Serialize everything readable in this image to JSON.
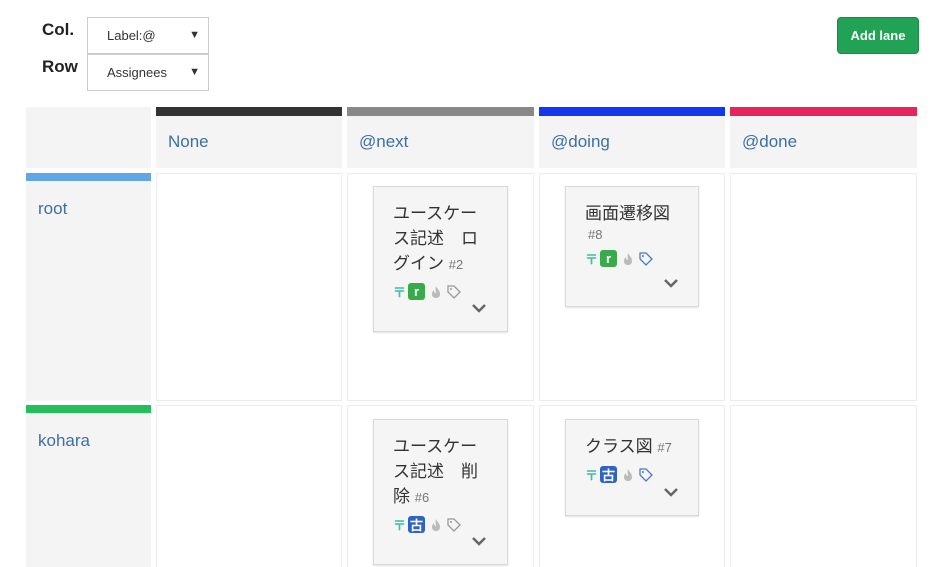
{
  "controls": {
    "col_label": "Col.",
    "row_label": "Row",
    "col_select": "Label:@",
    "row_select": "Assignees",
    "caret": "▼",
    "add_lane": "Add lane"
  },
  "columns": [
    {
      "name": "None",
      "color": "#333333"
    },
    {
      "name": "@next",
      "color": "#888888"
    },
    {
      "name": "@doing",
      "color": "#1238f2"
    },
    {
      "name": "@done",
      "color": "#e8245e"
    }
  ],
  "rows": [
    {
      "name": "root",
      "color": "#63a6e6"
    },
    {
      "name": "kohara",
      "color": "#22bf5b"
    }
  ],
  "cards": [
    {
      "lines": [
        "ユースケー",
        "ス記述　ロ",
        "グイン"
      ],
      "number": "#2",
      "pin": "〒",
      "avatar": "r",
      "icons": [
        "pin-icon",
        "avatar",
        "flame-icon",
        "tag-icon",
        "chevron-down-icon"
      ]
    },
    {
      "lines": [
        "画面遷移図"
      ],
      "number": "#8",
      "pin": "〒",
      "avatar": "r",
      "icons": [
        "pin-icon",
        "avatar",
        "flame-icon",
        "tag-icon",
        "chevron-down-icon"
      ]
    },
    {
      "lines": [
        "ユースケー",
        "ス記述　削",
        "除"
      ],
      "number": "#6",
      "pin": "〒",
      "avatar": "古",
      "icons": [
        "pin-icon",
        "avatar",
        "flame-icon",
        "tag-icon",
        "chevron-down-icon"
      ]
    },
    {
      "lines": [
        "クラス図"
      ],
      "number": "#7",
      "pin": "〒",
      "avatar": "古",
      "icons": [
        "pin-icon",
        "avatar",
        "flame-icon",
        "tag-icon",
        "chevron-down-icon"
      ]
    }
  ],
  "colors": {
    "accent_green": "#21a255",
    "link_blue": "#3d6fa5",
    "tag_blue": "#4a78d0"
  }
}
